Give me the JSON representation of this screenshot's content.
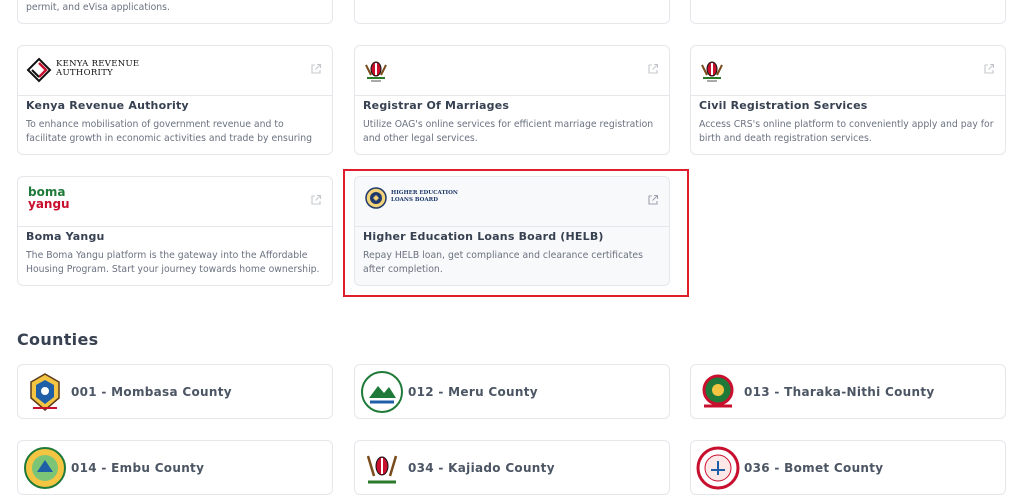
{
  "top_partial": {
    "desc": "permit, and eVisa applications."
  },
  "services": [
    {
      "logo_text": [
        "KENYA REVENUE",
        "AUTHORITY"
      ],
      "title": "Kenya Revenue Authority",
      "desc": "To enhance mobilisation of government revenue and to facilitate growth in economic activities and trade by ensuring complianc..."
    },
    {
      "title": "Registrar Of Marriages",
      "desc": "Utilize OAG's online services for efficient marriage registration and other legal services."
    },
    {
      "title": "Civil Registration Services",
      "desc": "Access CRS's online platform to conveniently apply and pay for birth and death registration services."
    },
    {
      "logo_text": [
        "boma",
        "yangu"
      ],
      "title": "Boma Yangu",
      "desc": "The Boma Yangu platform is the gateway into the Affordable Housing Program. Start your journey towards home ownership."
    },
    {
      "logo_text": [
        "HIGHER EDUCATION",
        "LOANS BOARD"
      ],
      "title": "Higher Education Loans Board (HELB)",
      "desc": "Repay HELB loan, get compliance and clearance certificates after completion."
    }
  ],
  "section": {
    "counties_title": "Counties"
  },
  "counties": [
    {
      "name": "001 - Mombasa County"
    },
    {
      "name": "012 - Meru County"
    },
    {
      "name": "013 - Tharaka-Nithi County"
    },
    {
      "name": "014 - Embu County"
    },
    {
      "name": "034 - Kajiado County"
    },
    {
      "name": "036 - Bomet County"
    }
  ],
  "colors": {
    "highlight": "#e11d2b",
    "border": "#e5e7eb",
    "kra_red": "#c8102e",
    "boma_green": "#1f7a3a"
  }
}
